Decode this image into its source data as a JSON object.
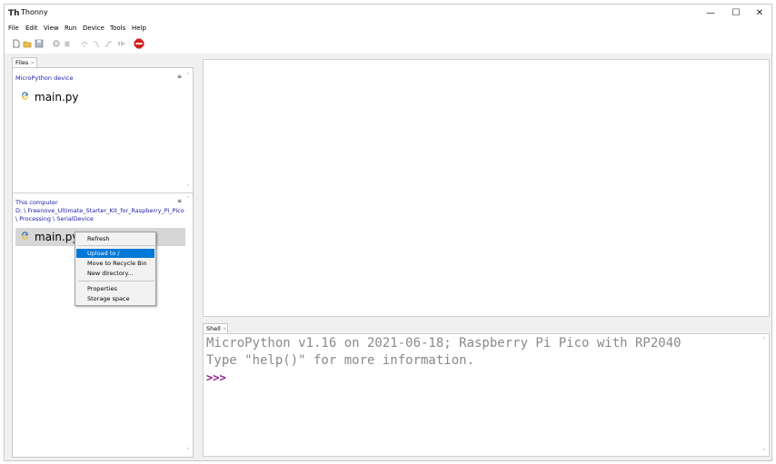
{
  "window": {
    "title": "Thonny",
    "app_icon": "Th",
    "minimize": "—",
    "maximize": "☐",
    "close": "✕"
  },
  "menubar": [
    "File",
    "Edit",
    "View",
    "Run",
    "Device",
    "Tools",
    "Help"
  ],
  "toolbar_icons": [
    "new-file-icon",
    "open-file-icon",
    "save-icon",
    "run-icon",
    "debug-icon",
    "step-over-icon",
    "step-into-icon",
    "step-out-icon",
    "resume-icon",
    "stop-icon"
  ],
  "files_panel": {
    "tab_label": "Files",
    "tab_close": "×",
    "device_section": {
      "title": "MicroPython device",
      "menu_glyph": "≡",
      "files": [
        "main.py"
      ]
    },
    "computer_section": {
      "title": "This computer",
      "path_line1": "D: \\ Freenove_Ultimate_Starter_Kit_for_Raspberry_Pi_Pico",
      "path_line2": "\\ Processing \\ SerialDevice",
      "menu_glyph": "≡",
      "files": [
        "main.py"
      ]
    }
  },
  "context_menu": {
    "items": [
      "Refresh",
      "Upload to /",
      "Move to Recycle Bin",
      "New directory...",
      "Properties",
      "Storage space"
    ],
    "highlighted": "Upload to /"
  },
  "shell": {
    "tab_label": "Shell",
    "tab_close": "×",
    "line1": "MicroPython v1.16 on 2021-06-18; Raspberry Pi Pico with RP2040",
    "line2": "Type \"help()\" for more information.",
    "prompt": ">>>"
  }
}
